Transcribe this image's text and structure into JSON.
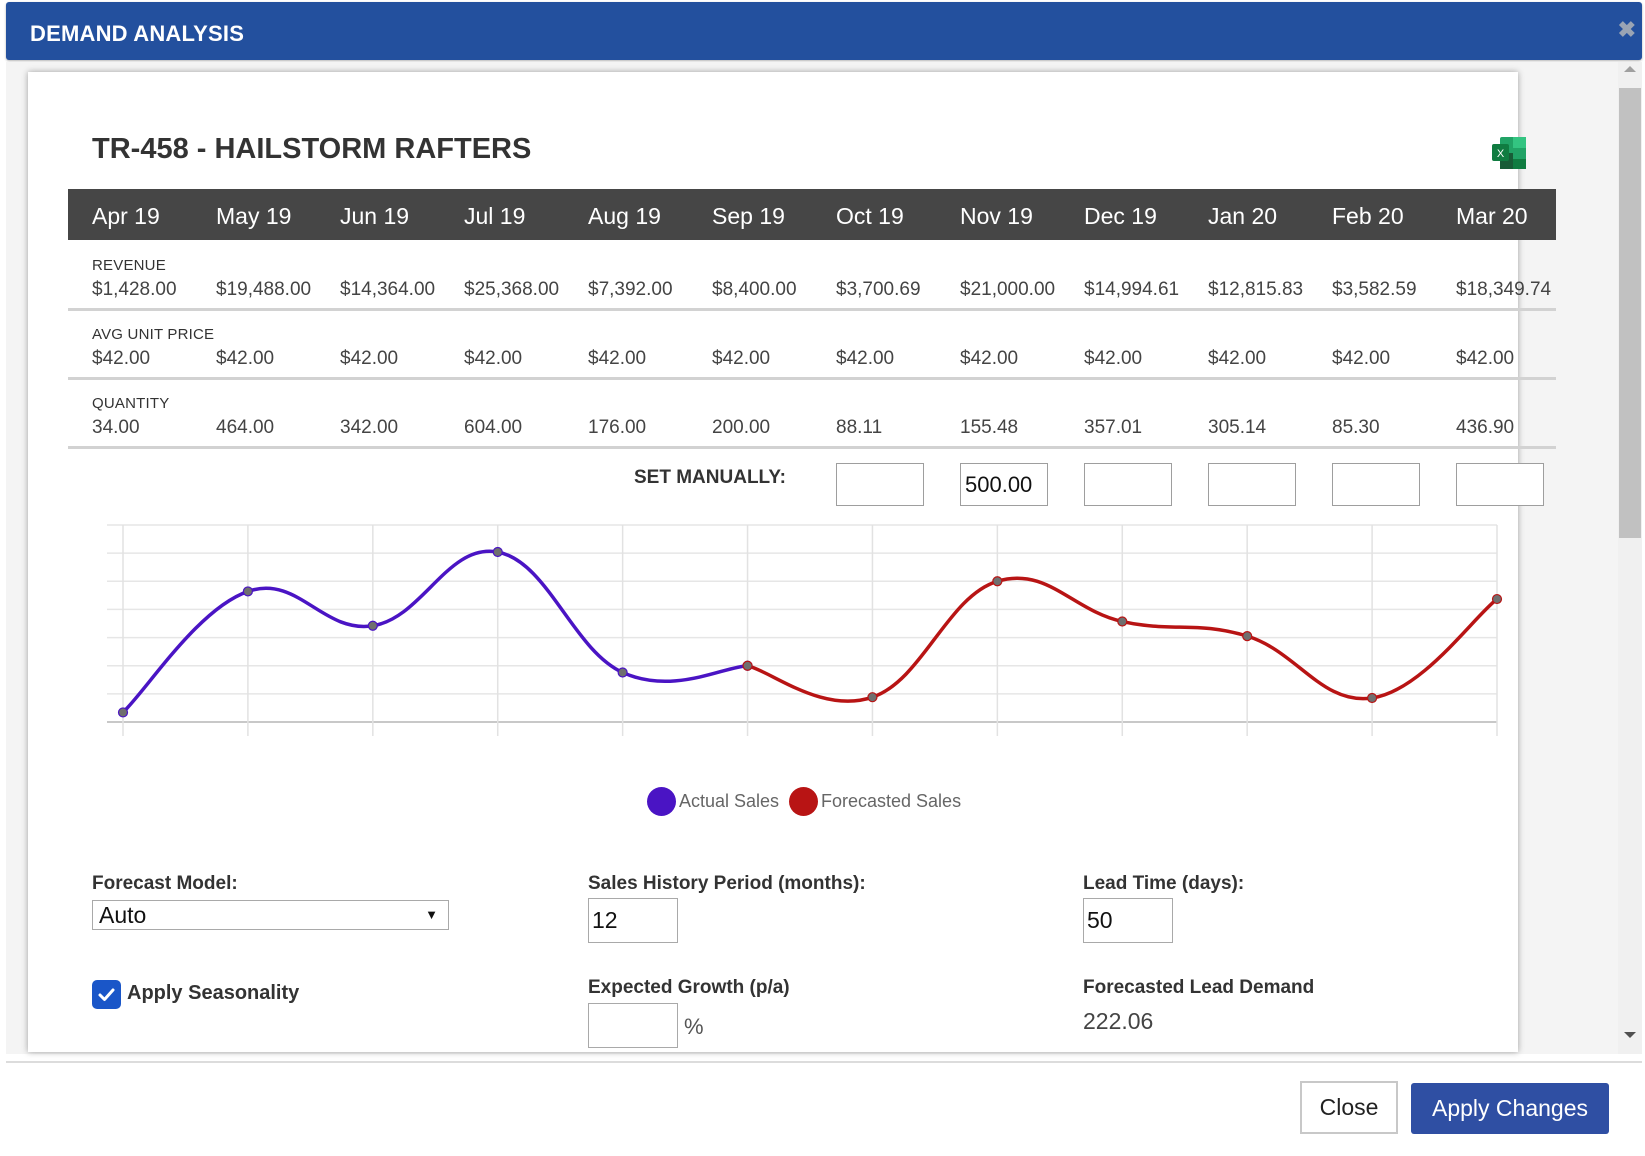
{
  "modal": {
    "title": "DEMAND ANALYSIS",
    "close_icon": "close-icon"
  },
  "product": {
    "title": "TR-458 - HAILSTORM RAFTERS",
    "export_icon": "excel-icon"
  },
  "months": [
    "Apr 19",
    "May 19",
    "Jun 19",
    "Jul 19",
    "Aug 19",
    "Sep 19",
    "Oct 19",
    "Nov 19",
    "Dec 19",
    "Jan 20",
    "Feb 20",
    "Mar 20"
  ],
  "rows": {
    "revenue": {
      "label": "REVENUE",
      "values": [
        "$1,428.00",
        "$19,488.00",
        "$14,364.00",
        "$25,368.00",
        "$7,392.00",
        "$8,400.00",
        "$3,700.69",
        "$21,000.00",
        "$14,994.61",
        "$12,815.83",
        "$3,582.59",
        "$18,349.74"
      ]
    },
    "avg_unit_price": {
      "label": "AVG UNIT PRICE",
      "values": [
        "$42.00",
        "$42.00",
        "$42.00",
        "$42.00",
        "$42.00",
        "$42.00",
        "$42.00",
        "$42.00",
        "$42.00",
        "$42.00",
        "$42.00",
        "$42.00"
      ]
    },
    "quantity": {
      "label": "QUANTITY",
      "values": [
        "34.00",
        "464.00",
        "342.00",
        "604.00",
        "176.00",
        "200.00",
        "88.11",
        "155.48",
        "357.01",
        "305.14",
        "85.30",
        "436.90"
      ]
    }
  },
  "set_manually": {
    "label": "SET MANUALLY:",
    "inputs": [
      {
        "month": "Oct 19",
        "value": ""
      },
      {
        "month": "Nov 19",
        "value": "500.00"
      },
      {
        "month": "Dec 19",
        "value": ""
      },
      {
        "month": "Jan 20",
        "value": ""
      },
      {
        "month": "Feb 20",
        "value": ""
      },
      {
        "month": "Mar 20",
        "value": ""
      }
    ]
  },
  "colors": {
    "actual": "#4a14c4",
    "forecast": "#b81414",
    "header": "#23509e",
    "month_bar": "#464646",
    "primary_button": "#2f4fa3",
    "checkbox": "#1a56c8"
  },
  "chart_data": {
    "type": "line",
    "title": "",
    "xlabel": "",
    "ylabel": "",
    "categories": [
      "Apr 19",
      "May 19",
      "Jun 19",
      "Jul 19",
      "Aug 19",
      "Sep 19",
      "Oct 19",
      "Nov 19",
      "Dec 19",
      "Jan 20",
      "Feb 20",
      "Mar 20"
    ],
    "series": [
      {
        "name": "Actual Sales",
        "color": "#4a14c4",
        "values": [
          34,
          464,
          342,
          604,
          176,
          200,
          null,
          null,
          null,
          null,
          null,
          null
        ]
      },
      {
        "name": "Forecasted Sales",
        "color": "#b81414",
        "values": [
          null,
          null,
          null,
          null,
          null,
          200,
          88.11,
          500,
          357.01,
          305.14,
          85.3,
          436.9
        ]
      }
    ],
    "ylim": [
      0,
      700
    ],
    "grid": true,
    "smooth": true,
    "legend": "bottom-center"
  },
  "legend": [
    {
      "label": "Actual Sales"
    },
    {
      "label": "Forecasted Sales"
    }
  ],
  "settings": {
    "forecast_model": {
      "label": "Forecast Model:",
      "value": "Auto"
    },
    "sales_history": {
      "label": "Sales History Period (months):",
      "value": "12"
    },
    "lead_time": {
      "label": "Lead Time (days):",
      "value": "50"
    },
    "apply_seasonality": {
      "label": "Apply Seasonality",
      "checked": true
    },
    "expected_growth": {
      "label": "Expected Growth (p/a)",
      "value": "",
      "unit": "%"
    },
    "forecasted_lead_demand": {
      "label": "Forecasted Lead Demand",
      "value": "222.06"
    }
  },
  "footer": {
    "close_label": "Close",
    "apply_label": "Apply Changes"
  }
}
